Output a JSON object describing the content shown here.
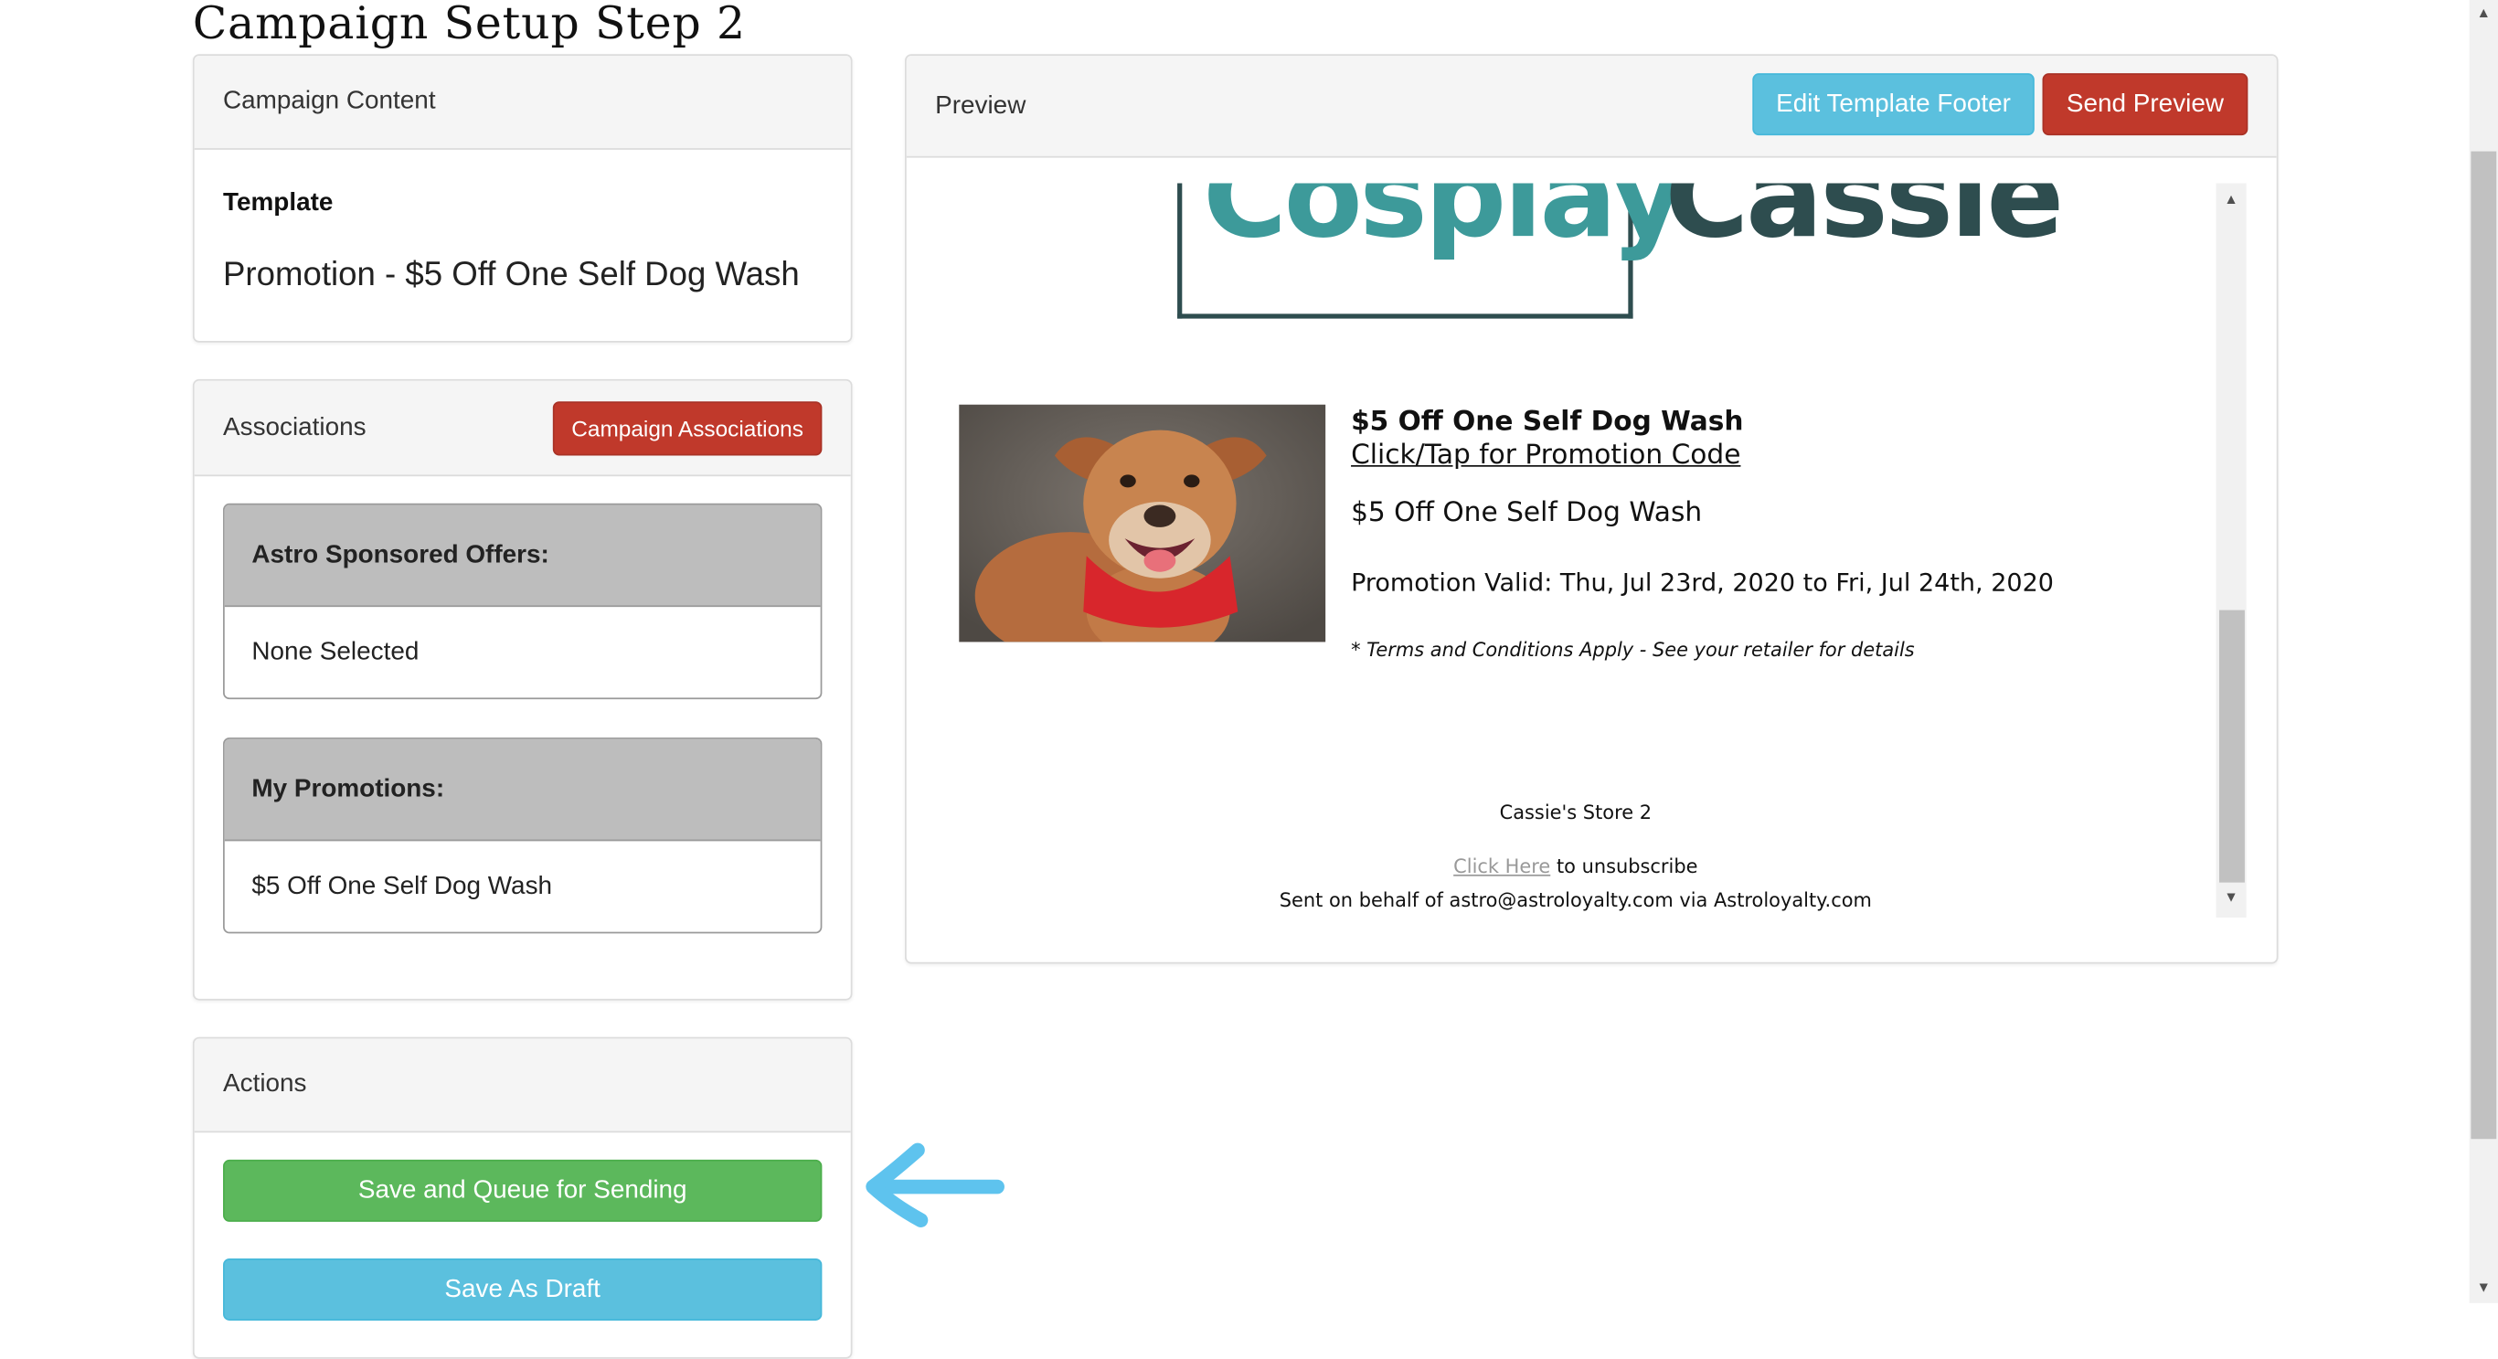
{
  "page": {
    "title": "Campaign Setup Step 2"
  },
  "content_panel": {
    "heading": "Campaign Content",
    "template_label": "Template",
    "template_name": "Promotion - $5 Off One Self Dog Wash"
  },
  "associations_panel": {
    "heading": "Associations",
    "button_label": "Campaign Associations",
    "groups": [
      {
        "title": "Astro Sponsored Offers:",
        "value": "None Selected"
      },
      {
        "title": "My Promotions:",
        "value": "$5 Off One Self Dog Wash"
      }
    ]
  },
  "actions_panel": {
    "heading": "Actions",
    "save_queue_label": "Save and Queue for Sending",
    "save_draft_label": "Save As Draft"
  },
  "preview_panel": {
    "heading": "Preview",
    "edit_footer_label": "Edit Template Footer",
    "send_preview_label": "Send Preview",
    "email": {
      "logo_left": "Cosplay",
      "logo_right": "Cassie",
      "promo_title": "$5 Off One Self Dog Wash",
      "promo_link": "Click/Tap for Promotion Code",
      "promo_subtitle": "$5 Off One Self Dog Wash",
      "promo_validity": "Promotion Valid: Thu, Jul 23rd, 2020 to Fri, Jul 24th, 2020",
      "terms": "* Terms and Conditions Apply - See your retailer for details",
      "store_name": "Cassie's Store 2",
      "unsubscribe_link": "Click Here",
      "unsubscribe_text": "to unsubscribe",
      "sent_on_behalf": "Sent on behalf of astro@astroloyalty.com via Astroloyalty.com"
    }
  },
  "colors": {
    "danger": "#c0392b",
    "info": "#5bc0de",
    "success": "#5cb85c",
    "annotation_arrow": "#5ec3ee",
    "logo_teal": "#3d9a9a",
    "logo_dark": "#2e4d4f"
  },
  "icons": [
    "left-arrow-annotation-icon",
    "scroll-up-arrow-icon",
    "scroll-down-arrow-icon"
  ]
}
